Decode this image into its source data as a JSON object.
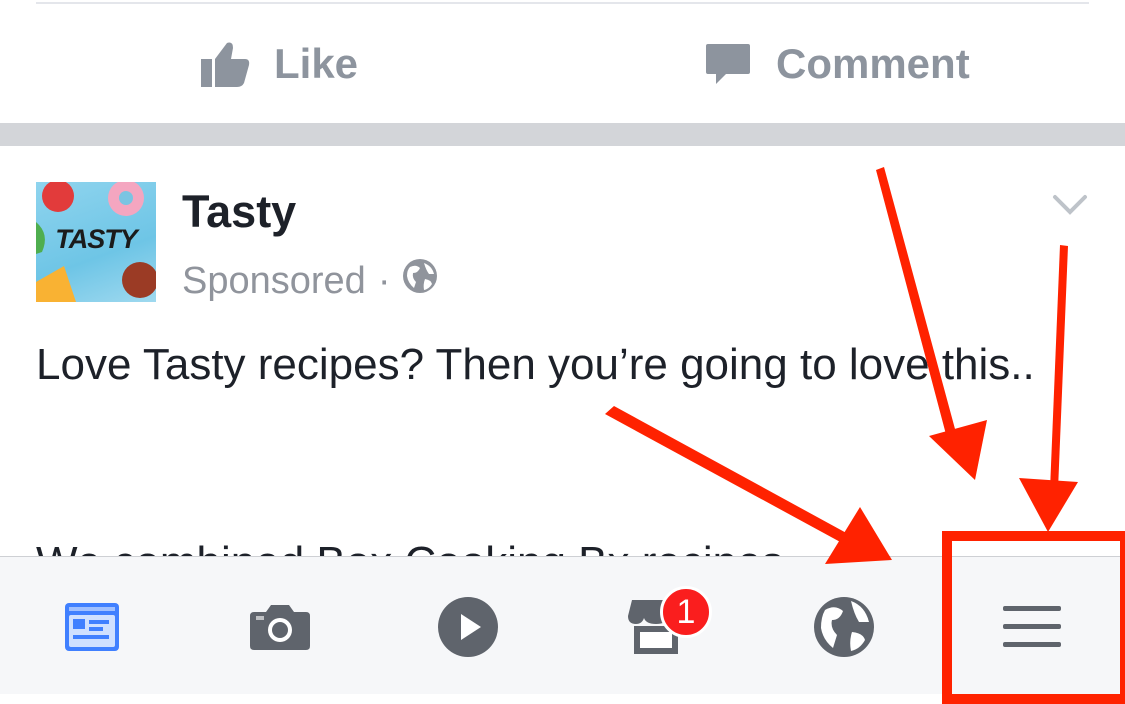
{
  "actions": {
    "like_label": "Like",
    "comment_label": "Comment"
  },
  "post": {
    "page_name": "Tasty",
    "avatar_text": "TASTY",
    "sponsored_label": "Sponsored",
    "separator": "·",
    "text": "Love Tasty recipes? Then you’re going to love this..",
    "partial_text": "We combined Box Cooking Bx recipes"
  },
  "tabbar": {
    "items": [
      "news-feed-icon",
      "camera-icon",
      "video-play-icon",
      "marketplace-icon",
      "globe-icon",
      "menu-icon"
    ],
    "marketplace_badge": "1"
  },
  "colors": {
    "accent": "#4080ff",
    "icon_gray": "#5f646c",
    "badge": "#fa1e1e",
    "annotation": "#ff2200"
  }
}
